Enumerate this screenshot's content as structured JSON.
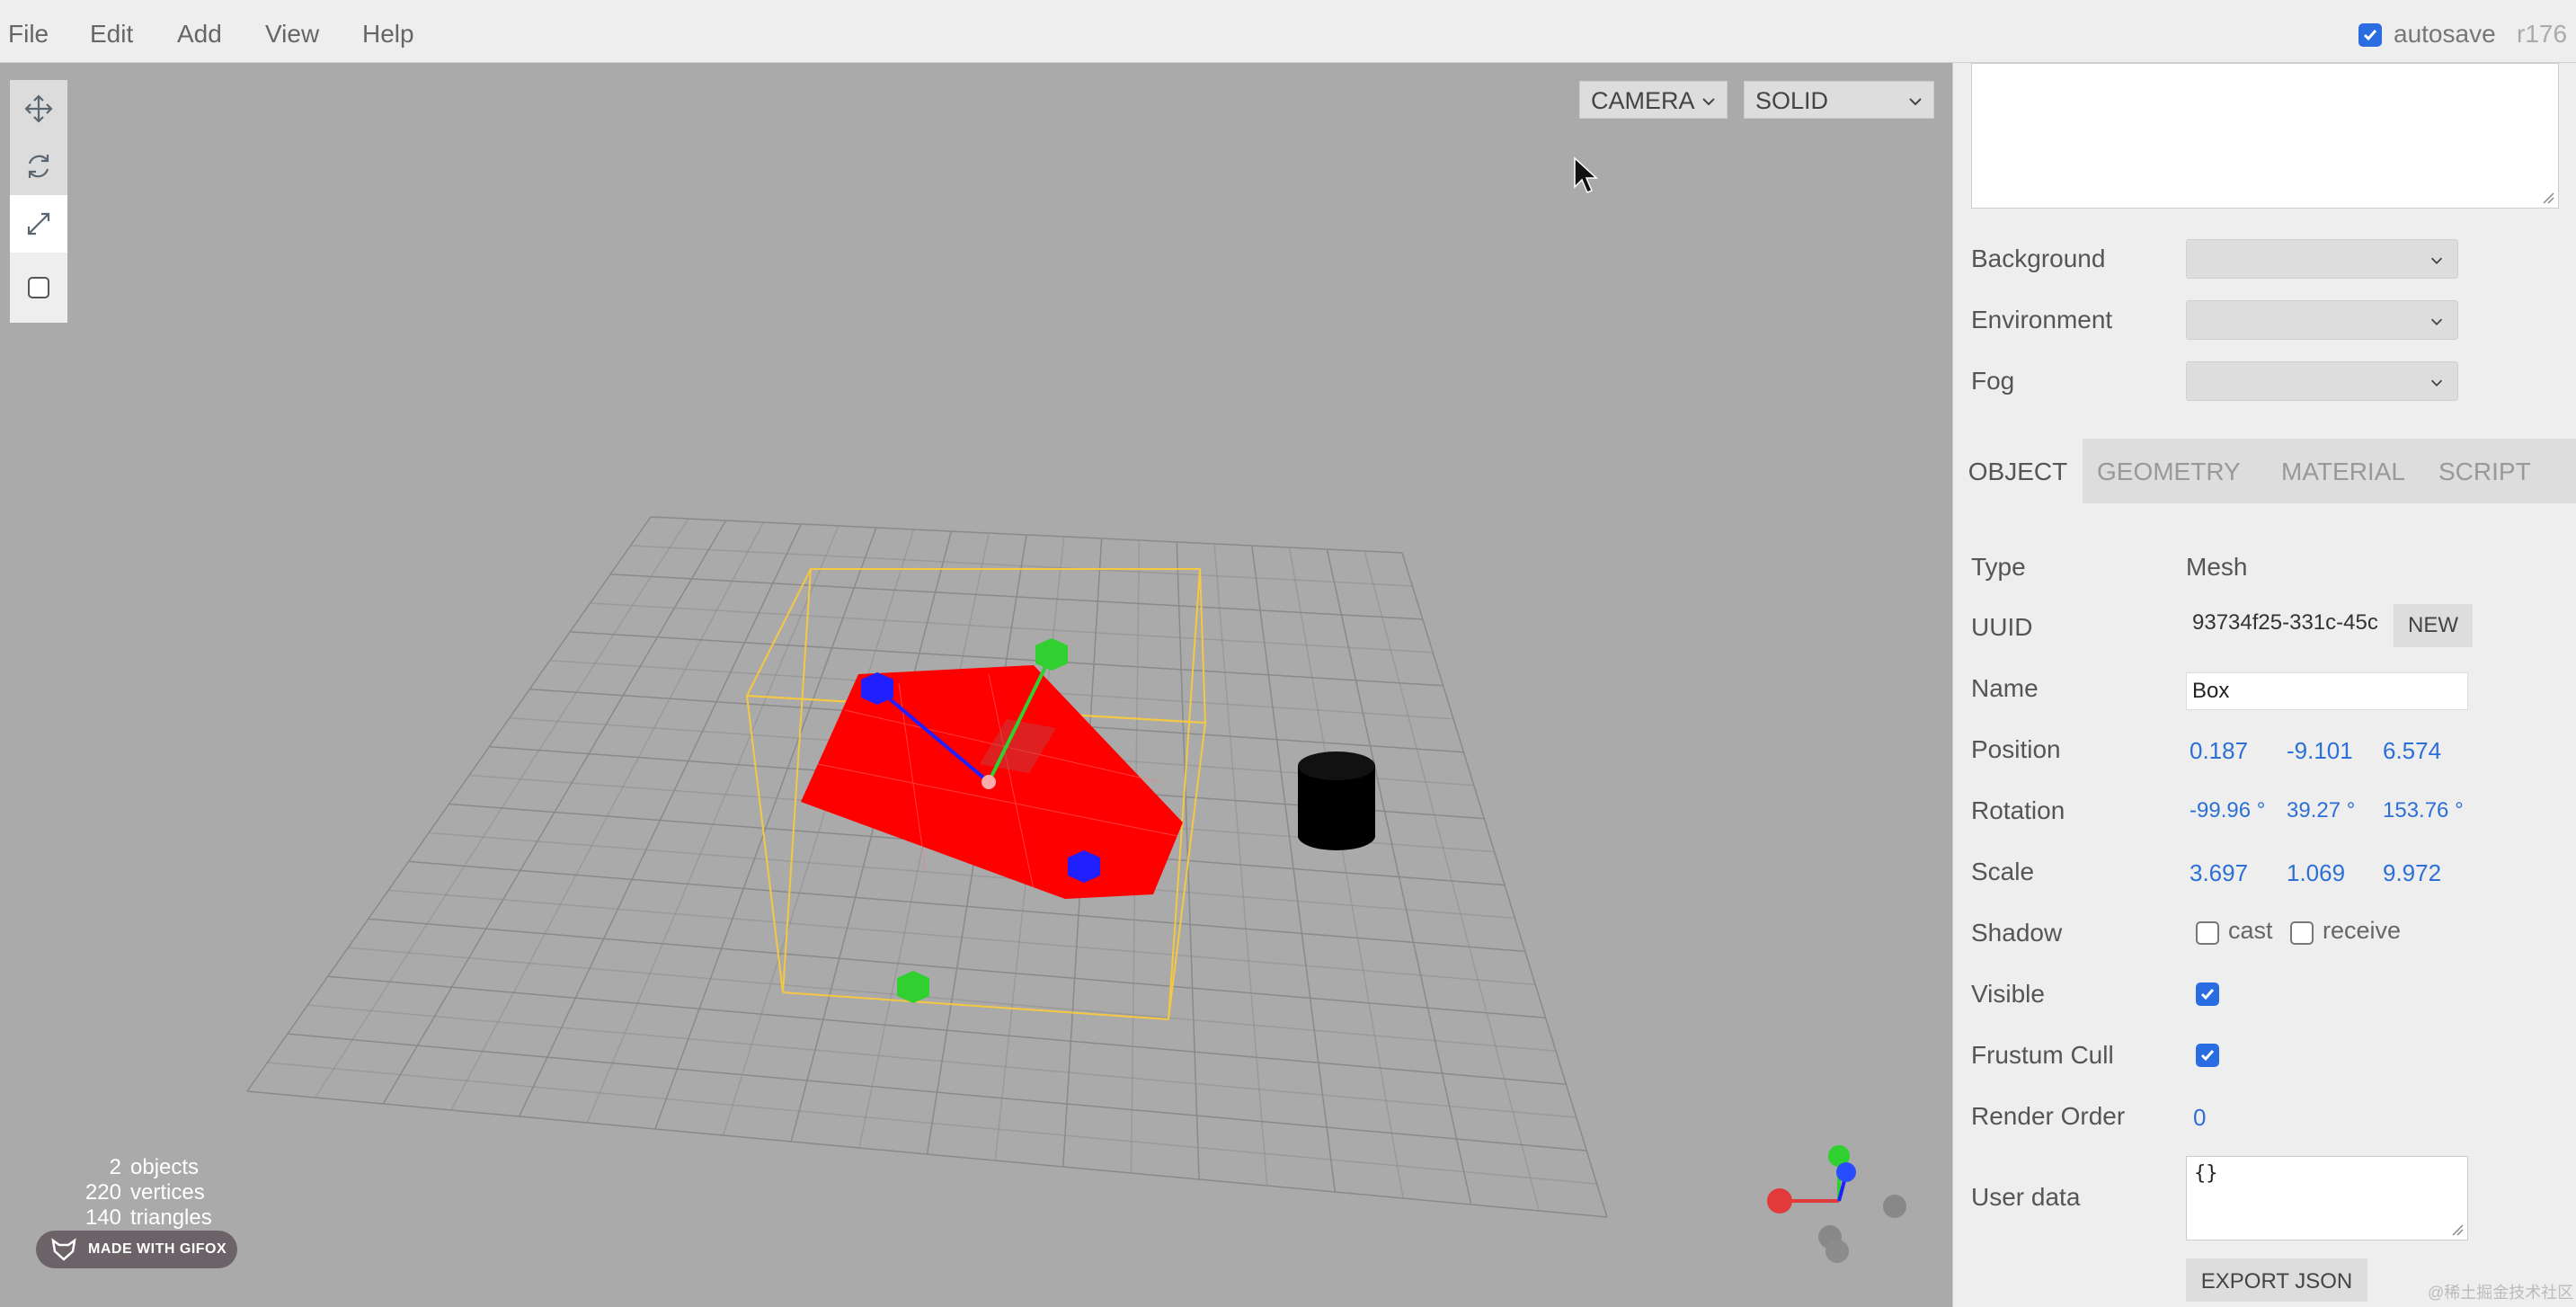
{
  "menubar": {
    "items": [
      "File",
      "Edit",
      "Add",
      "View",
      "Help"
    ],
    "autosave_label": "autosave",
    "autosave_checked": true,
    "version": "r176"
  },
  "viewport": {
    "camera_select": "CAMERA",
    "shading_select": "SOLID",
    "tools": [
      "move-icon",
      "rotate-icon",
      "scale-icon",
      "local-icon"
    ],
    "info": {
      "objects_count": "2",
      "objects_label": "objects",
      "vertices_count": "220",
      "vertices_label": "vertices",
      "triangles_count": "140",
      "triangles_label": "triangles"
    },
    "gifox_badge": "MADE WITH GIFOX"
  },
  "sidebar": {
    "scene": {
      "background_label": "Background",
      "environment_label": "Environment",
      "fog_label": "Fog"
    },
    "tabs": [
      "OBJECT",
      "GEOMETRY",
      "MATERIAL",
      "SCRIPT"
    ],
    "active_tab": "OBJECT",
    "object": {
      "type_label": "Type",
      "type_value": "Mesh",
      "uuid_label": "UUID",
      "uuid_value": "93734f25-331c-45c",
      "new_button": "NEW",
      "name_label": "Name",
      "name_value": "Box",
      "position_label": "Position",
      "position": [
        "0.187",
        "-9.101",
        "6.574"
      ],
      "rotation_label": "Rotation",
      "rotation": [
        "-99.96 °",
        "39.27 °",
        "153.76 °"
      ],
      "scale_label": "Scale",
      "scale": [
        "3.697",
        "1.069",
        "9.972"
      ],
      "shadow_label": "Shadow",
      "cast_label": "cast",
      "cast_checked": false,
      "receive_label": "receive",
      "receive_checked": false,
      "visible_label": "Visible",
      "visible_checked": true,
      "frustum_label": "Frustum Cull",
      "frustum_checked": true,
      "render_order_label": "Render Order",
      "render_order_value": "0",
      "userdata_label": "User data",
      "userdata_value": "{}",
      "export_button": "EXPORT JSON"
    },
    "watermark": "@稀土掘金技术社区"
  },
  "colors": {
    "viewport_bg": "#aaaaaa",
    "panel_bg": "#eeeeee",
    "accent_blue": "#2a6de0",
    "value_blue": "#2c6fd6",
    "mesh_red": "#ff0000",
    "selection_yellow": "#ffd24a"
  }
}
